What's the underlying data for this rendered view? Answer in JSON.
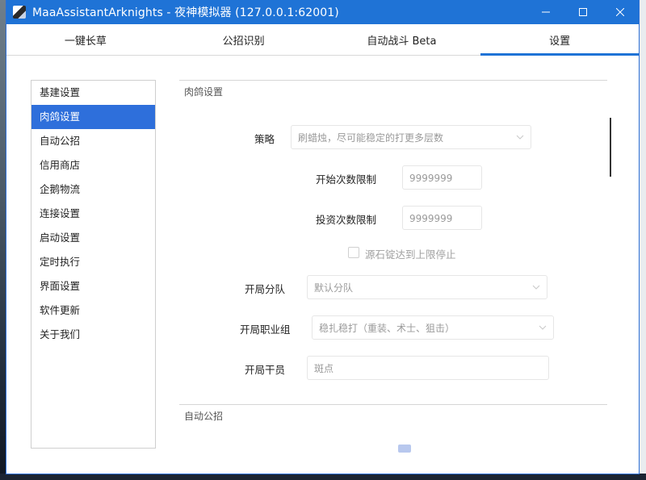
{
  "window": {
    "title": "MaaAssistantArknights - 夜神模拟器 (127.0.0.1:62001)"
  },
  "tabs": [
    {
      "label": "一键长草"
    },
    {
      "label": "公招识别"
    },
    {
      "label": "自动战斗 Beta"
    },
    {
      "label": "设置",
      "active": true
    }
  ],
  "sidebar": {
    "items": [
      {
        "label": "基建设置"
      },
      {
        "label": "肉鸽设置",
        "active": true
      },
      {
        "label": "自动公招"
      },
      {
        "label": "信用商店"
      },
      {
        "label": "企鹅物流"
      },
      {
        "label": "连接设置"
      },
      {
        "label": "启动设置"
      },
      {
        "label": "定时执行"
      },
      {
        "label": "界面设置"
      },
      {
        "label": "软件更新"
      },
      {
        "label": "关于我们"
      }
    ]
  },
  "roguelike": {
    "section_title": "肉鸽设置",
    "strategy_label": "策略",
    "strategy_value": "刷蜡烛，尽可能稳定的打更多层数",
    "start_limit_label": "开始次数限制",
    "start_limit_value": "9999999",
    "invest_limit_label": "投资次数限制",
    "invest_limit_value": "9999999",
    "stop_checkbox_label": "源石锭达到上限停止",
    "squad_label": "开局分队",
    "squad_value": "默认分队",
    "roles_label": "开局职业组",
    "roles_value": "稳扎稳打（重装、术士、狙击）",
    "operator_label": "开局干员",
    "operator_placeholder": "斑点"
  },
  "recruit": {
    "section_title": "自动公招"
  },
  "colors": {
    "accent": "#1f73d6",
    "selected": "#2e6fdb"
  }
}
